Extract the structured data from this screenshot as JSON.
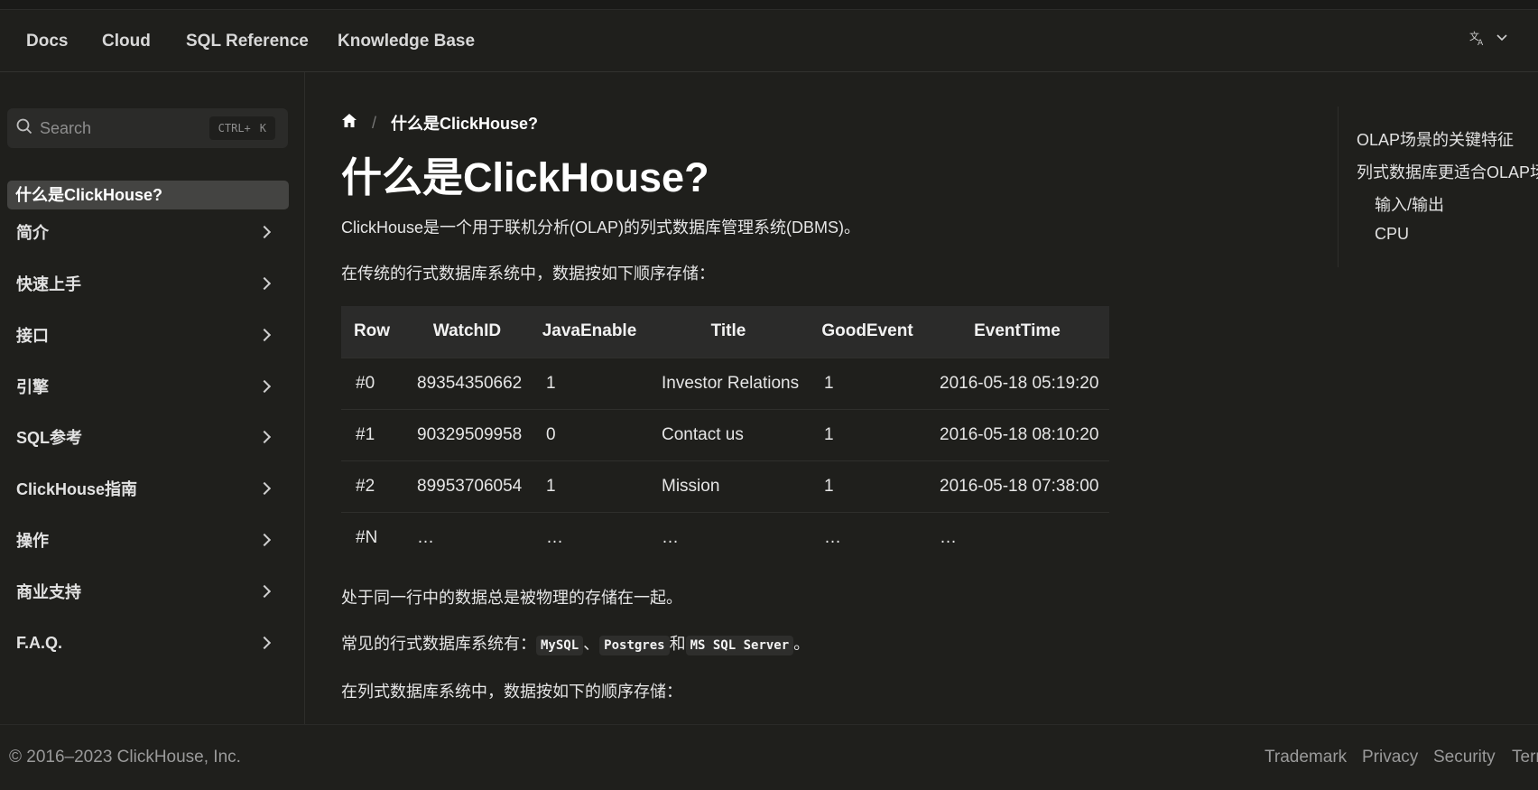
{
  "nav": {
    "links": [
      "Docs",
      "Cloud",
      "SQL Reference",
      "Knowledge Base"
    ]
  },
  "search": {
    "placeholder": "Search",
    "shortcut_mod": "CTRL+",
    "shortcut_key": "K"
  },
  "sidebar": {
    "active": "什么是ClickHouse?",
    "items": [
      "简介",
      "快速上手",
      "接口",
      "引擎",
      "SQL参考",
      "ClickHouse指南",
      "操作",
      "商业支持",
      "F.A.Q."
    ]
  },
  "breadcrumb": {
    "current": "什么是ClickHouse?"
  },
  "page": {
    "title": "什么是ClickHouse?",
    "intro": "ClickHouse是一个用于联机分析(OLAP)的列式数据库管理系统(DBMS)。",
    "row_store_intro": "在传统的行式数据库系统中，数据按如下顺序存储：",
    "row_note": "处于同一行中的数据总是被物理的存储在一起。",
    "common_prefix": "常见的行式数据库系统有：",
    "db1": "MySQL",
    "sep1": "、",
    "db2": "Postgres",
    "and": "和",
    "db3": "MS SQL Server",
    "period": "。",
    "col_store_intro": "在列式数据库系统中，数据按如下的顺序存储："
  },
  "table": {
    "headers": [
      "Row",
      "WatchID",
      "JavaEnable",
      "Title",
      "GoodEvent",
      "EventTime"
    ],
    "rows": [
      [
        "#0",
        "89354350662",
        "1",
        "Investor Relations",
        "1",
        "2016-05-18 05:19:20"
      ],
      [
        "#1",
        "90329509958",
        "0",
        "Contact us",
        "1",
        "2016-05-18 08:10:20"
      ],
      [
        "#2",
        "89953706054",
        "1",
        "Mission",
        "1",
        "2016-05-18 07:38:00"
      ],
      [
        "#N",
        "…",
        "…",
        "…",
        "…",
        "…"
      ]
    ]
  },
  "toc": {
    "items": [
      "OLAP场景的关键特征",
      "列式数据库更适合OLAP场",
      "输入/输出",
      "CPU"
    ]
  },
  "footer": {
    "copyright": "© 2016–2023 ClickHouse, Inc.",
    "links": [
      "Trademark",
      "Privacy",
      "Security",
      "Term"
    ]
  }
}
